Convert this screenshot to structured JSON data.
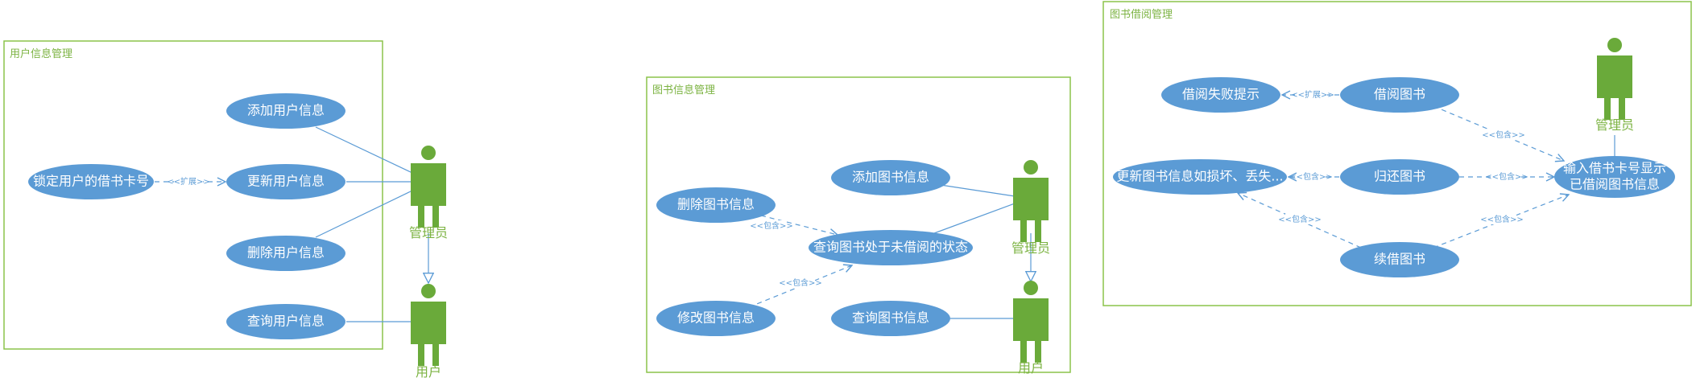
{
  "frames": {
    "user": {
      "title": "用户信息管理"
    },
    "book": {
      "title": "图书信息管理"
    },
    "borrow": {
      "title": "图书借阅管理"
    }
  },
  "actors": {
    "admin": "管理员",
    "user": "用户"
  },
  "usecases": {
    "add_user": "添加用户信息",
    "update_user": "更新用户信息",
    "delete_user": "删除用户信息",
    "query_user": "查询用户信息",
    "lock_card": "锁定用户的借书卡号",
    "add_book": "添加图书信息",
    "delete_book": "删除图书信息",
    "modify_book": "修改图书信息",
    "query_book": "查询图书信息",
    "check_status": "查询图书处于未借阅的状态",
    "borrow_book": "借阅图书",
    "return_book": "归还图书",
    "renew_book": "续借图书",
    "borrow_fail": "借阅失败提示",
    "update_damage": "更新图书信息如损坏、丢失...",
    "input_card_l1": "输入借书卡号显示",
    "input_card_l2": "已借阅图书信息"
  },
  "stereotypes": {
    "extend": "<<扩展>>",
    "include": "<<包含>>"
  },
  "colors": {
    "frame": "#8bc34a",
    "usecase": "#5b9bd5",
    "actor": "#6aaa3a"
  }
}
